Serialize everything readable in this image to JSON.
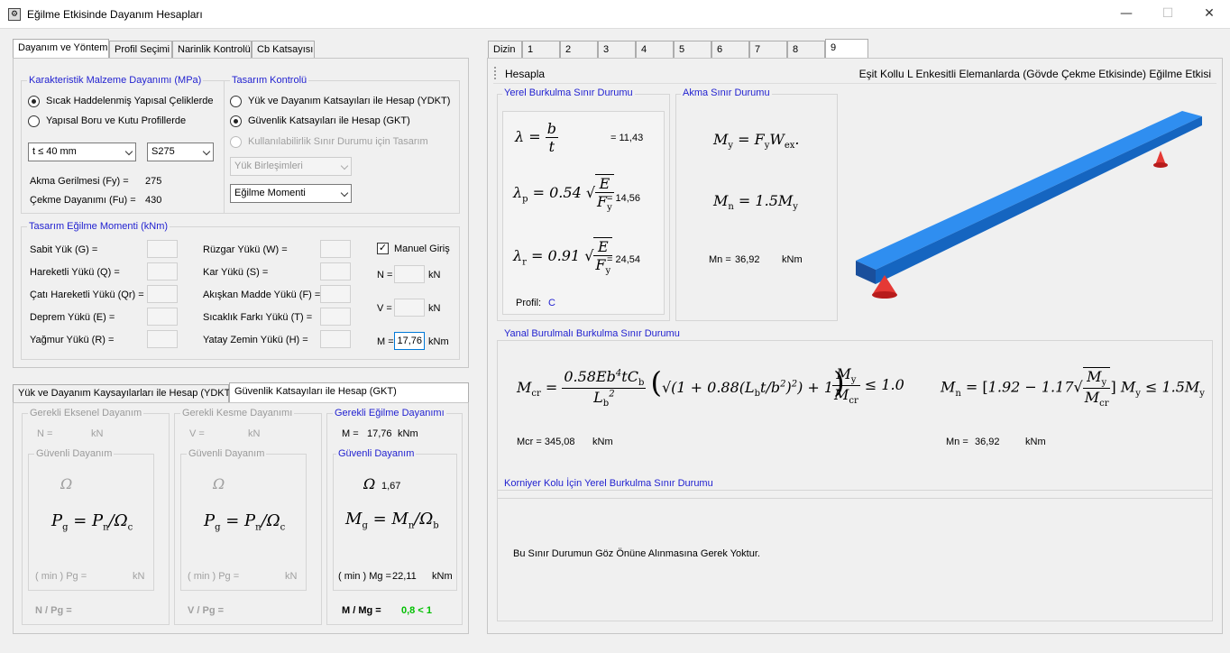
{
  "window": {
    "title": "Eğilme Etkisinde Dayanım Hesapları",
    "minimize": "—",
    "maximize": "☐",
    "close": "✕",
    "icon": "gear-icon"
  },
  "left_tabs": [
    "Dayanım ve Yöntem",
    "Profil Seçimi",
    "Narinlik Kontrolü",
    "Cb Katsayısı"
  ],
  "material": {
    "group_label": "Karakteristik Malzeme Dayanımı (MPa)",
    "opt1": "Sıcak Haddelenmiş Yapısal Çeliklerde",
    "opt2": "Yapısal Boru ve Kutu Profillerde",
    "thickness": "t ≤ 40 mm",
    "grade": "S275",
    "fy_label": "Akma Gerilmesi (Fy) =",
    "fy_value": "275",
    "fu_label": "Çekme Dayanımı (Fu) =",
    "fu_value": "430"
  },
  "design": {
    "group_label": "Tasarım Kontrolü",
    "opt1": "Yük ve Dayanım Katsayıları ile Hesap (YDKT)",
    "opt2": "Güvenlik Katsayıları ile Hesap (GKT)",
    "opt3": "Kullanılabilirlik Sınır Durumu için Tasarım",
    "combo1": "Yük Birleşimleri",
    "combo2": "Eğilme Momenti"
  },
  "moments": {
    "group_label": "Tasarım Eğilme Momenti (kNm)",
    "g": "Sabit Yük (G) =",
    "q": "Hareketli Yükü (Q) =",
    "qr": "Çatı Hareketli Yükü (Qr) =",
    "e": "Deprem Yükü (E) =",
    "r": "Yağmur Yükü (R) =",
    "w": "Rüzgar Yükü (W) =",
    "s": "Kar Yükü (S) =",
    "f": "Akışkan Madde Yükü (F) =",
    "t": "Sıcaklık Farkı Yükü (T) =",
    "h": "Yatay Zemin Yükü (H) =",
    "manual": "Manuel Giriş",
    "n_label": "N =",
    "v_label": "V =",
    "m_label": "M =",
    "m_value": "17,76",
    "kn": "kN",
    "knm": "kNm"
  },
  "method_tabs": [
    "Yük ve Dayanım Kaysayılarları ile Hesap (YDKT)",
    "Güvenlik Katsayıları ile Hesap (GKT)"
  ],
  "axial": {
    "label": "Gerekli Eksenel Dayanım",
    "n": "N =",
    "unit": "kN",
    "safe": "Güvenli Dayanım",
    "omega": "Ω",
    "min": "( min ) Pg =",
    "ratio": "N / Pg ="
  },
  "shear": {
    "label": "Gerekli Kesme Dayanımı",
    "v": "V =",
    "unit": "kN",
    "safe": "Güvenli Dayanım",
    "omega": "Ω",
    "min": "( min ) Pg =",
    "ratio": "V / Pg ="
  },
  "bending": {
    "label": "Gerekli Eğilme Dayanımı",
    "m": "M =",
    "m_value": "17,76",
    "unit": "kNm",
    "safe": "Güvenli Dayanım",
    "omega": "Ω",
    "omega_value": "1,67",
    "min": "( min ) Mg =",
    "mg_value": "22,11",
    "ratio": "M / Mg =",
    "result": "0,8 < 1"
  },
  "right_tabs": [
    "Dizin",
    "1",
    "2",
    "3",
    "4",
    "5",
    "6",
    "7",
    "8",
    "9"
  ],
  "toolbar": {
    "hesapla": "Hesapla",
    "title": "Eşit Kollu L Enkesitli Elemanlarda (Gövde Çekme Etkisinde) Eğilme Etkisi"
  },
  "local": {
    "label": "Yerel Burkulma Sınır Durumu",
    "lambda": "= 11,43",
    "lambda_p": "= 14,56",
    "lambda_r": "= 24,54",
    "profil_label": "Profil:",
    "profil_value": "C"
  },
  "yield": {
    "label": "Akma Sınır Durumu",
    "mn": "Mn =",
    "mn_value": "36,92",
    "unit": "kNm"
  },
  "ltb": {
    "label": "Yanal Burulmalı Burkulma Sınır Durumu",
    "mcr": "Mcr = 345,08",
    "mcr_unit": "kNm",
    "mn": "Mn =",
    "mn_value": "36,92",
    "mn_unit": "kNm"
  },
  "flange": {
    "label": "Korniyer Kolu İçin Yerel Burkulma Sınır Durumu",
    "note": "Bu Sınır Durumun Göz Önüne Alınmasına Gerek Yoktur."
  },
  "colors": {
    "accent": "#1f1fd0",
    "beam": "#1e88e5",
    "support": "#e53935",
    "ok": "#00c000"
  }
}
